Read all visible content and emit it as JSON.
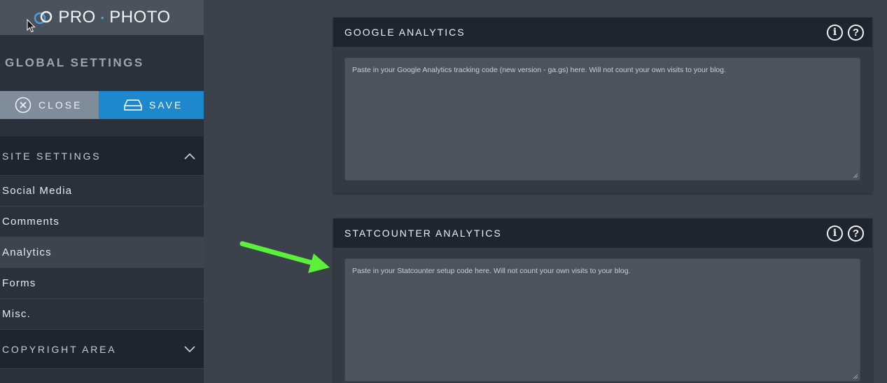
{
  "brand": {
    "logo_left": "PRO",
    "logo_right": "PHOTO",
    "logo_dot": "•"
  },
  "sidebar": {
    "title": "GLOBAL SETTINGS",
    "close_label": "CLOSE",
    "save_label": "SAVE",
    "sections": [
      {
        "label": "SITE SETTINGS",
        "expanded": true,
        "items": [
          {
            "label": "Social Media"
          },
          {
            "label": "Comments"
          },
          {
            "label": "Analytics",
            "active": true
          },
          {
            "label": "Forms"
          },
          {
            "label": "Misc."
          }
        ]
      },
      {
        "label": "COPYRIGHT AREA",
        "expanded": false
      }
    ]
  },
  "main": {
    "panels": [
      {
        "title": "GOOGLE ANALYTICS",
        "placeholder": "Paste in your Google Analytics tracking code (new version - ga.gs) here. Will not count your own visits to your blog."
      },
      {
        "title": "STATCOUNTER ANALYTICS",
        "placeholder": "Paste in your Statcounter setup code here. Will not count your own visits to your blog."
      }
    ]
  },
  "colors": {
    "accent_save": "#1e88cf",
    "arrow": "#5bf03a",
    "close_button": "#7f8c99"
  }
}
